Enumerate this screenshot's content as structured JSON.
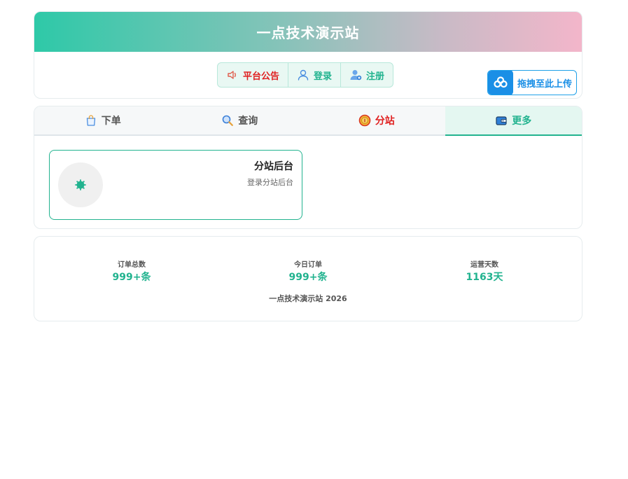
{
  "header": {
    "title": "一点技术演示站"
  },
  "nav": {
    "notice_label": "平台公告",
    "login_label": "登录",
    "register_label": "注册"
  },
  "upload": {
    "label": "拖拽至此上传",
    "icon": "cloud-icon"
  },
  "tabs": [
    {
      "label": "下单",
      "icon": "shopping-bag-icon"
    },
    {
      "label": "查询",
      "icon": "search-icon"
    },
    {
      "label": "分站",
      "icon": "coin-icon"
    },
    {
      "label": "更多",
      "icon": "wallet-icon",
      "active": true
    }
  ],
  "entry": {
    "title": "分站后台",
    "subtitle": "登录分站后台",
    "icon": "gear-icon"
  },
  "stats": [
    {
      "label": "订单总数",
      "value": "999+条"
    },
    {
      "label": "今日订单",
      "value": "999+条"
    },
    {
      "label": "运营天数",
      "value": "1163天"
    }
  ],
  "footer": {
    "text": "一点技术演示站 2026"
  },
  "colors": {
    "accent": "#22b38f",
    "notice": "#e02020",
    "upload": "#1a8fe6"
  }
}
